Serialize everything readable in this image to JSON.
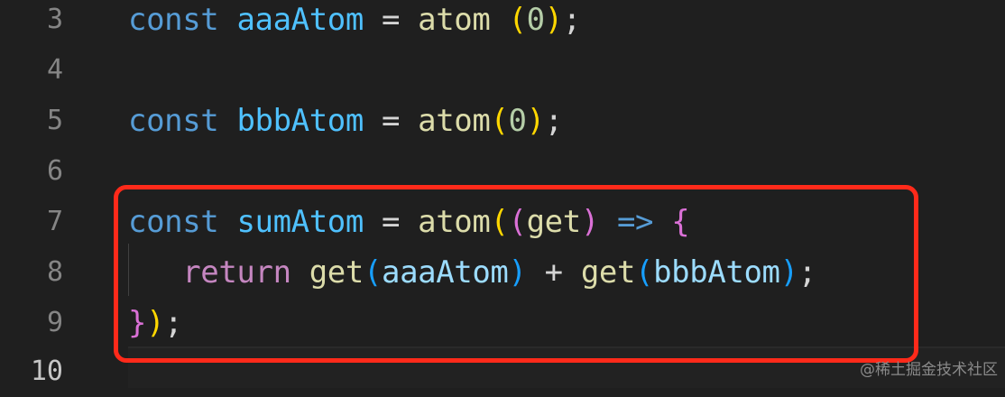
{
  "editor": {
    "lines": [
      {
        "number": "3",
        "tokens": [
          {
            "text": "const",
            "cls": "kw"
          },
          {
            "text": " ",
            "cls": "op"
          },
          {
            "text": "aaaAtom",
            "cls": "var"
          },
          {
            "text": " = ",
            "cls": "op"
          },
          {
            "text": "atom",
            "cls": "fn"
          },
          {
            "text": " ",
            "cls": "op"
          },
          {
            "text": "(",
            "cls": "b1"
          },
          {
            "text": "0",
            "cls": "num"
          },
          {
            "text": ")",
            "cls": "b1"
          },
          {
            "text": ";",
            "cls": "op"
          }
        ]
      },
      {
        "number": "4",
        "tokens": []
      },
      {
        "number": "5",
        "tokens": [
          {
            "text": "const",
            "cls": "kw"
          },
          {
            "text": " ",
            "cls": "op"
          },
          {
            "text": "bbbAtom",
            "cls": "var"
          },
          {
            "text": " = ",
            "cls": "op"
          },
          {
            "text": "atom",
            "cls": "fn"
          },
          {
            "text": "(",
            "cls": "b1"
          },
          {
            "text": "0",
            "cls": "num"
          },
          {
            "text": ")",
            "cls": "b1"
          },
          {
            "text": ";",
            "cls": "op"
          }
        ]
      },
      {
        "number": "6",
        "tokens": []
      },
      {
        "number": "7",
        "tokens": [
          {
            "text": "const",
            "cls": "kw"
          },
          {
            "text": " ",
            "cls": "op"
          },
          {
            "text": "sumAtom",
            "cls": "var"
          },
          {
            "text": " = ",
            "cls": "op"
          },
          {
            "text": "atom",
            "cls": "fn"
          },
          {
            "text": "(",
            "cls": "b1"
          },
          {
            "text": "(",
            "cls": "b2"
          },
          {
            "text": "get",
            "cls": "fn"
          },
          {
            "text": ")",
            "cls": "b2"
          },
          {
            "text": " ",
            "cls": "op"
          },
          {
            "text": "=>",
            "cls": "kw"
          },
          {
            "text": " ",
            "cls": "op"
          },
          {
            "text": "{",
            "cls": "b2"
          }
        ]
      },
      {
        "number": "8",
        "tokens": [
          {
            "text": "   ",
            "cls": "op"
          },
          {
            "text": "return",
            "cls": "ret"
          },
          {
            "text": " ",
            "cls": "op"
          },
          {
            "text": "get",
            "cls": "fn"
          },
          {
            "text": "(",
            "cls": "b3"
          },
          {
            "text": "aaaAtom",
            "cls": "param"
          },
          {
            "text": ")",
            "cls": "b3"
          },
          {
            "text": " + ",
            "cls": "op"
          },
          {
            "text": "get",
            "cls": "fn"
          },
          {
            "text": "(",
            "cls": "b3"
          },
          {
            "text": "bbbAtom",
            "cls": "param"
          },
          {
            "text": ")",
            "cls": "b3"
          },
          {
            "text": ";",
            "cls": "op"
          }
        ]
      },
      {
        "number": "9",
        "tokens": [
          {
            "text": "}",
            "cls": "b2"
          },
          {
            "text": ")",
            "cls": "b1"
          },
          {
            "text": ";",
            "cls": "op"
          }
        ]
      },
      {
        "number": "10",
        "tokens": [],
        "active": true
      }
    ]
  },
  "watermark": "@稀土掘金技术社区",
  "colors": {
    "background": "#1f1f1f",
    "highlight_box": "#ff2a1a"
  }
}
